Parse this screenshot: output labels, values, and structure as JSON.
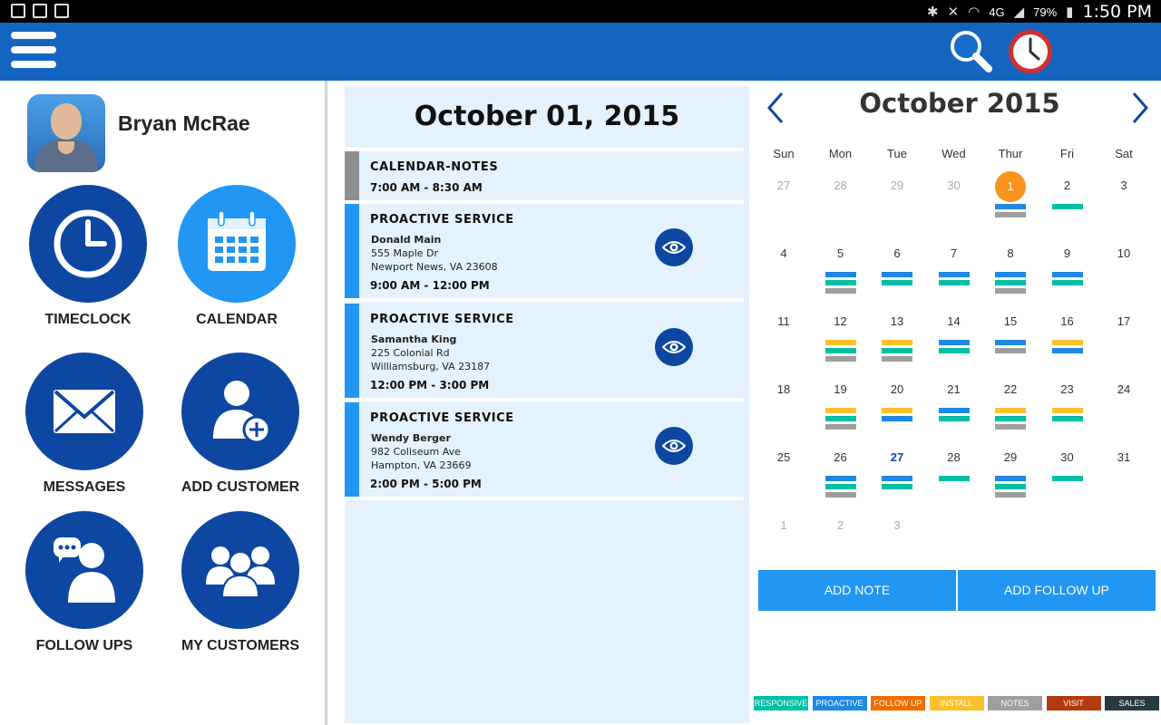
{
  "status_bar": {
    "battery": "79%",
    "time": "1:50 PM",
    "network": "4G"
  },
  "app_bar": {
    "menu_icon": "hamburger-icon",
    "search_icon": "search-icon",
    "clock_icon": "clock-icon"
  },
  "sidebar": {
    "user_name": "Bryan McRae",
    "tiles": [
      {
        "label": "TIMECLOCK",
        "icon": "clock-icon"
      },
      {
        "label": "CALENDAR",
        "icon": "calendar-icon"
      },
      {
        "label": "MESSAGES",
        "icon": "envelope-icon"
      },
      {
        "label": "ADD CUSTOMER",
        "icon": "add-person-icon"
      },
      {
        "label": "FOLLOW UPS",
        "icon": "chat-person-icon"
      },
      {
        "label": "MY CUSTOMERS",
        "icon": "group-icon"
      }
    ]
  },
  "agenda": {
    "date": "October 01, 2015",
    "items": [
      {
        "type": "CALENDAR-NOTES",
        "time": "7:00 AM -  8:30 AM"
      },
      {
        "type": "PROACTIVE SERVICE",
        "name": "Donald Main",
        "street": "555 Maple Dr",
        "city": "Newport News, VA 23608",
        "time": "9:00 AM - 12:00 PM"
      },
      {
        "type": "PROACTIVE SERVICE",
        "name": "Samantha King",
        "street": "225 Colonial Rd",
        "city": "Williamsburg, VA 23187",
        "time": "12:00 PM -  3:00 PM"
      },
      {
        "type": "PROACTIVE SERVICE",
        "name": "Wendy Berger",
        "street": "982 Coliseum Ave",
        "city": "Hampton, VA 23669",
        "time": "2:00 PM -  5:00 PM"
      }
    ]
  },
  "calendar": {
    "title": "October 2015",
    "weekdays": [
      "Sun",
      "Mon",
      "Tue",
      "Wed",
      "Thur",
      "Fri",
      "Sat"
    ],
    "selected_day": "1",
    "today_day": "27",
    "weeks": [
      [
        "27",
        "28",
        "29",
        "30",
        "1",
        "2",
        "3"
      ],
      [
        "4",
        "5",
        "6",
        "7",
        "8",
        "9",
        "10"
      ],
      [
        "11",
        "12",
        "13",
        "14",
        "15",
        "16",
        "17"
      ],
      [
        "18",
        "19",
        "20",
        "21",
        "22",
        "23",
        "24"
      ],
      [
        "25",
        "26",
        "27",
        "28",
        "29",
        "30",
        "31"
      ],
      [
        "1",
        "2",
        "3",
        "",
        "",
        "",
        ""
      ]
    ],
    "event_marks": [
      [
        [],
        [],
        [],
        [],
        [
          "proactive",
          "notes"
        ],
        [
          "responsive"
        ],
        []
      ],
      [
        [],
        [
          "proactive",
          "responsive",
          "notes"
        ],
        [
          "proactive",
          "responsive"
        ],
        [
          "proactive",
          "responsive"
        ],
        [
          "proactive",
          "responsive",
          "notes"
        ],
        [
          "proactive",
          "responsive"
        ],
        []
      ],
      [
        [],
        [
          "install",
          "responsive",
          "notes"
        ],
        [
          "install",
          "responsive",
          "notes"
        ],
        [
          "proactive",
          "responsive"
        ],
        [
          "proactive",
          "notes"
        ],
        [
          "install",
          "proactive"
        ],
        []
      ],
      [
        [],
        [
          "install",
          "responsive",
          "notes"
        ],
        [
          "install",
          "proactive"
        ],
        [
          "proactive",
          "responsive"
        ],
        [
          "install",
          "responsive",
          "notes"
        ],
        [
          "install",
          "responsive"
        ],
        []
      ],
      [
        [],
        [
          "proactive",
          "responsive",
          "notes"
        ],
        [
          "proactive",
          "responsive"
        ],
        [
          "responsive"
        ],
        [
          "proactive",
          "responsive",
          "notes"
        ],
        [
          "responsive"
        ],
        []
      ],
      [
        [],
        [],
        [],
        [],
        [],
        [],
        []
      ]
    ],
    "add_note_label": "ADD NOTE",
    "add_follow_up_label": "ADD FOLLOW UP"
  },
  "legend": [
    {
      "label": "RESPONSIVE",
      "color": "#00bfa5"
    },
    {
      "label": "PROACTIVE",
      "color": "#1e88e5"
    },
    {
      "label": "FOLLOW UP",
      "color": "#ef6c00"
    },
    {
      "label": "INSTALL",
      "color": "#fbc02d"
    },
    {
      "label": "NOTES",
      "color": "#9e9e9e"
    },
    {
      "label": "VISIT",
      "color": "#b23a10"
    },
    {
      "label": "SALES",
      "color": "#263a40"
    }
  ],
  "colors": {
    "app_bar": "#1565c0",
    "tile_dark": "#0d47a1",
    "tile_light": "#2196f3",
    "agenda_bg": "#e3f2fd",
    "selected_day": "#f7931e",
    "button": "#2196f3"
  }
}
